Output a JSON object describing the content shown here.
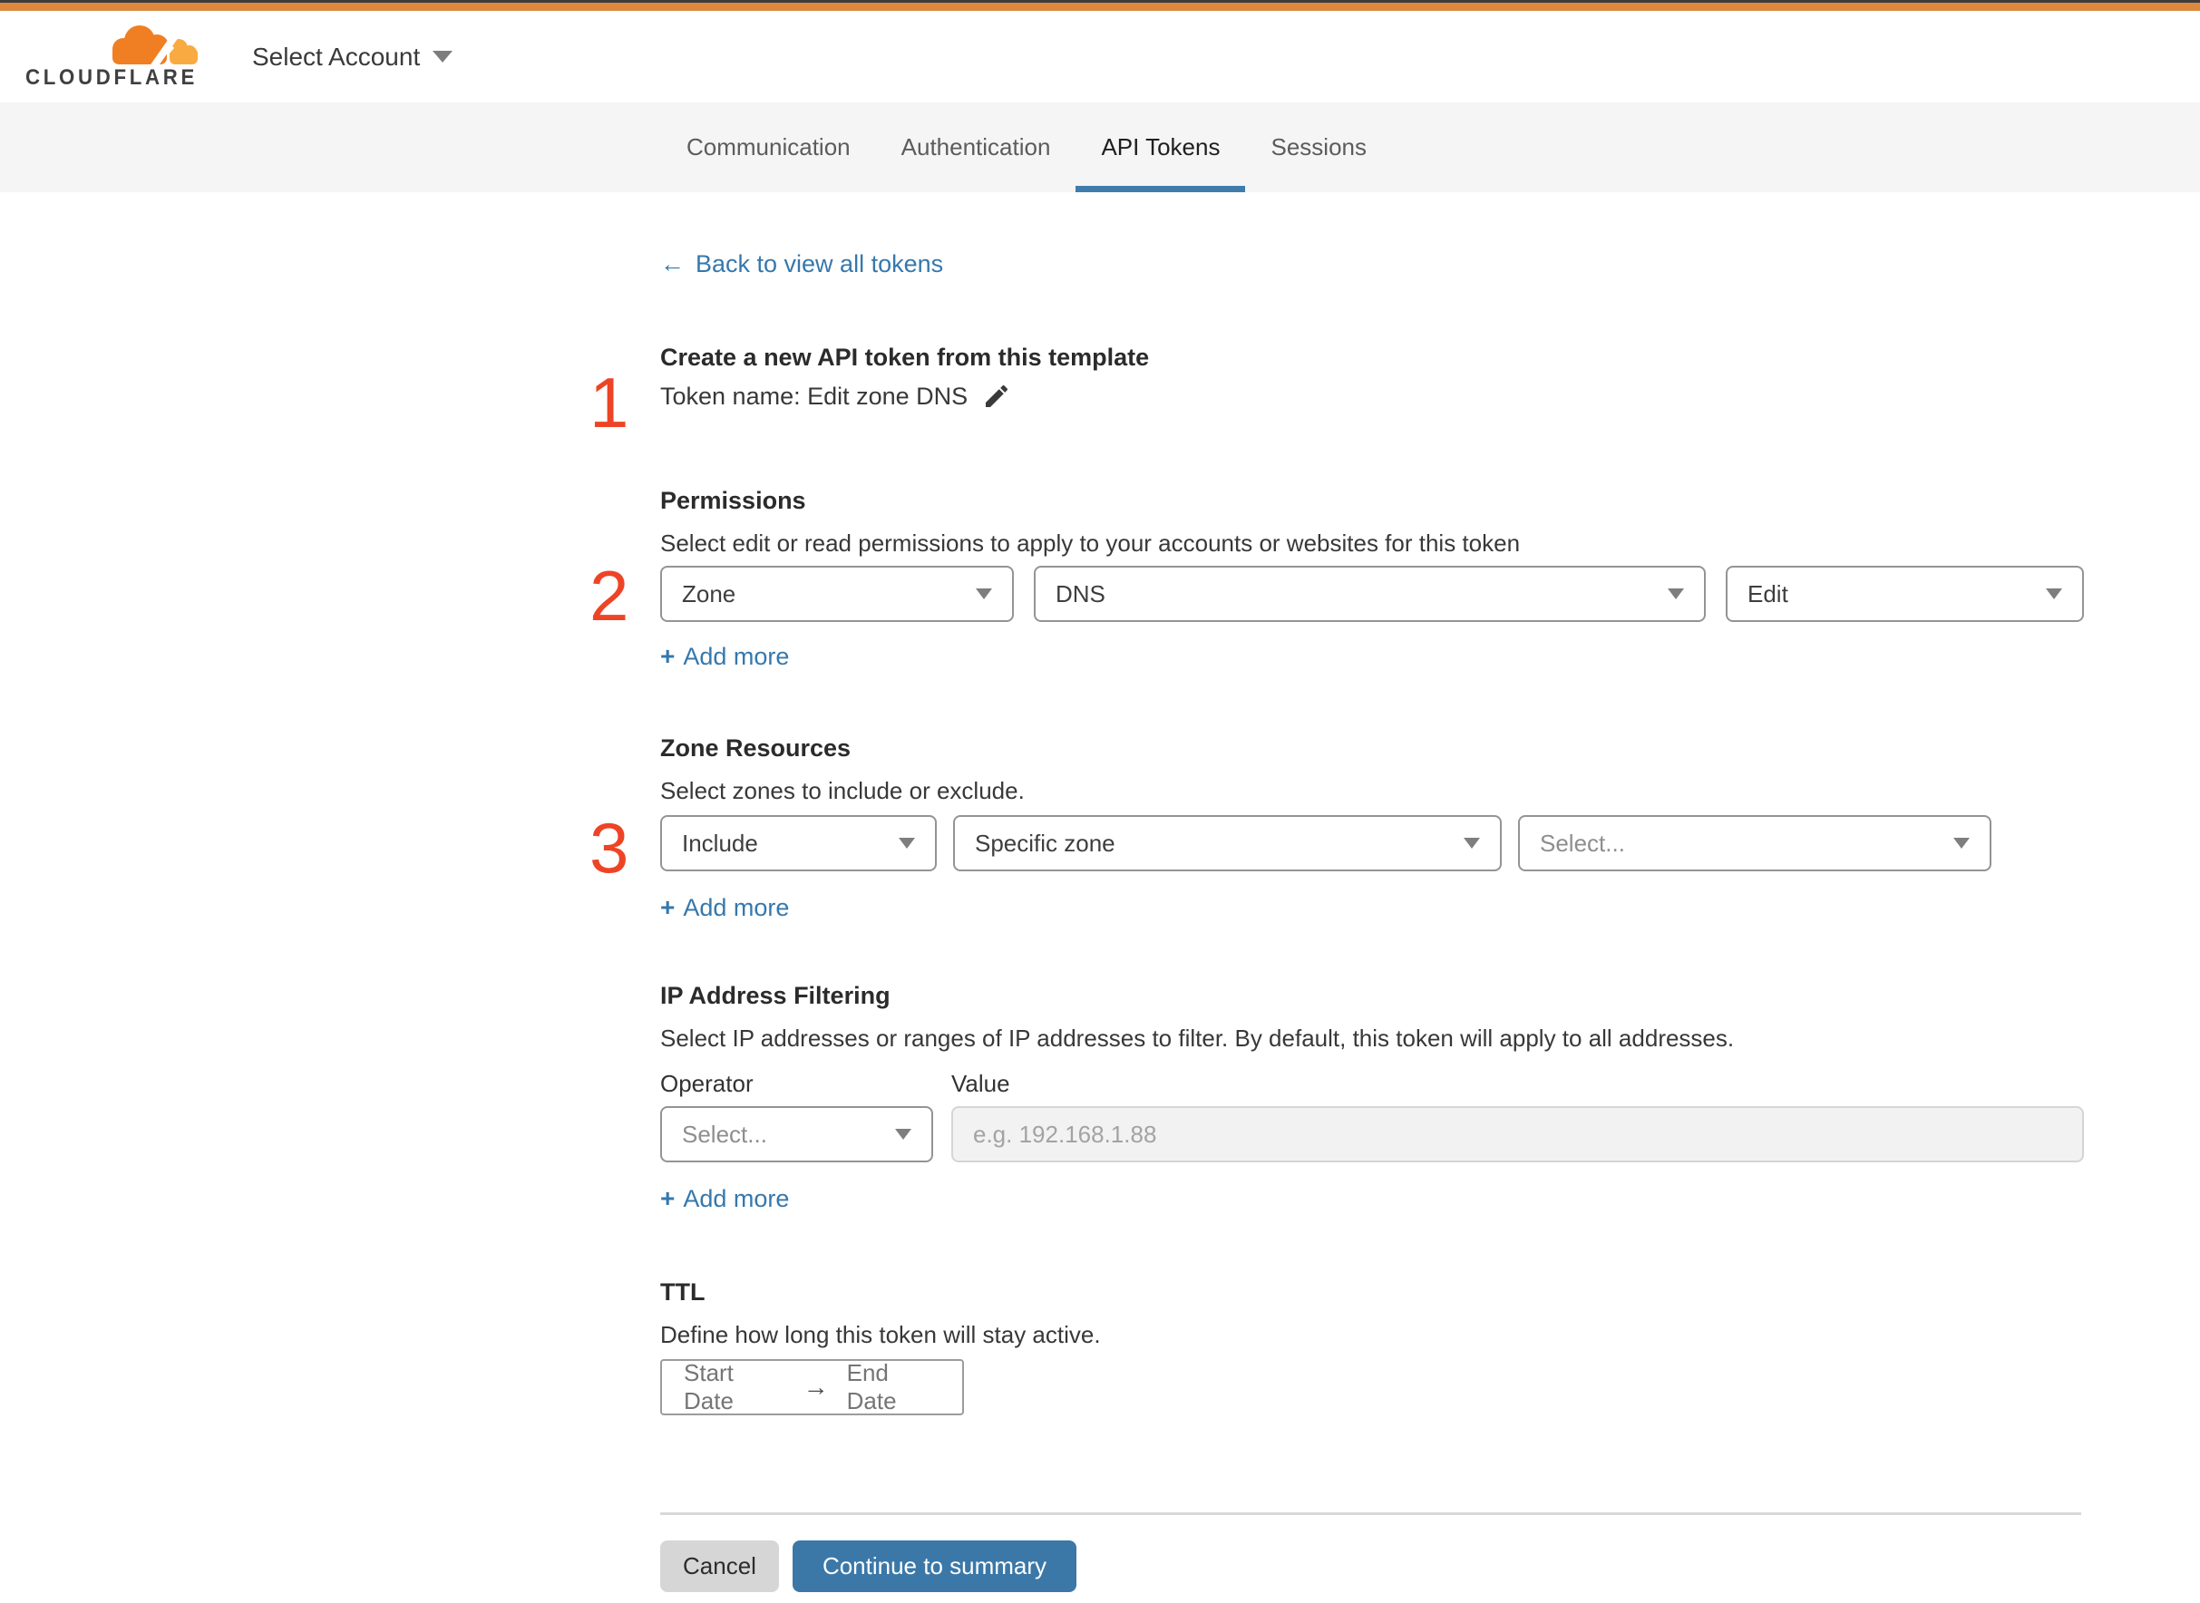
{
  "colors": {
    "top_bar_orange": "#dd8a3e",
    "brand_orange": "#f07f23",
    "brand_orange_light": "#f9ab41",
    "link_blue": "#3578ad",
    "button_blue": "#3b78a8",
    "tab_underline_blue": "#3f7cab",
    "step_number_red": "#ee4426"
  },
  "header": {
    "logo_text": "CLOUDFLARE",
    "account_selector": "Select Account"
  },
  "tabs": [
    {
      "label": "Communication",
      "active": false
    },
    {
      "label": "Authentication",
      "active": false
    },
    {
      "label": "API Tokens",
      "active": true
    },
    {
      "label": "Sessions",
      "active": false
    }
  ],
  "back": {
    "arrow": "←",
    "label": "Back to view all tokens"
  },
  "step_markers": [
    "1",
    "2",
    "3"
  ],
  "add_more": {
    "plus": "+",
    "label": "Add more"
  },
  "sections": {
    "token": {
      "heading": "Create a new API token from this template",
      "token_name": "Token name: Edit zone DNS"
    },
    "permissions": {
      "heading": "Permissions",
      "description": "Select edit or read permissions to apply to your accounts or websites for this token",
      "scope": "Zone",
      "resource": "DNS",
      "access": "Edit"
    },
    "zone_resources": {
      "heading": "Zone Resources",
      "description": "Select zones to include or exclude.",
      "operator": "Include",
      "type": "Specific zone",
      "zone_placeholder": "Select..."
    },
    "ip_filtering": {
      "heading": "IP Address Filtering",
      "description": "Select IP addresses or ranges of IP addresses to filter. By default, this token will apply to all addresses.",
      "operator_label": "Operator",
      "value_label": "Value",
      "operator_placeholder": "Select...",
      "value_placeholder": "e.g. 192.168.1.88"
    },
    "ttl": {
      "heading": "TTL",
      "description": "Define how long this token will stay active.",
      "start_label": "Start Date",
      "arrow": "→",
      "end_label": "End Date"
    }
  },
  "footer": {
    "cancel": "Cancel",
    "continue": "Continue to summary"
  }
}
